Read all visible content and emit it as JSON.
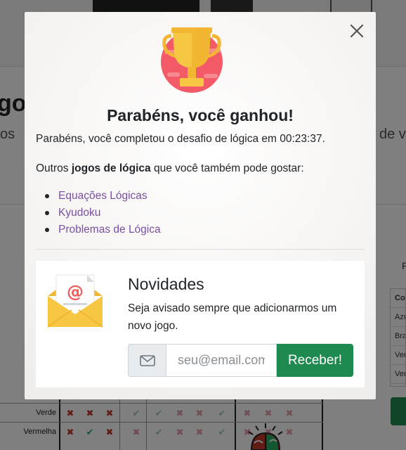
{
  "background": {
    "heading_fragment": "go",
    "sub_left_fragment": "os",
    "sub_right_fragment": "de v",
    "right_col_label": "P",
    "right_table": [
      "Co",
      "Azu",
      "Bra",
      "Ver",
      "Ver"
    ],
    "grid_rows": [
      {
        "label": "Verde",
        "cells": [
          "x",
          "x",
          "x",
          "fok",
          "fok",
          "fx",
          "fx",
          "fok",
          "fx",
          "fx",
          "fx"
        ]
      },
      {
        "label": "Vermelha",
        "cells": [
          "x",
          "ok",
          "x",
          "fx",
          "fok",
          "fx",
          "fx",
          "fok",
          "fx",
          "fx",
          "fx"
        ]
      }
    ]
  },
  "modal": {
    "close_label": "×",
    "trophy_icon": "trophy-icon",
    "title": "Parabéns, você ganhou!",
    "message": "Parabéns, você completou o desafio de lógica em 00:23:37.",
    "others_prefix": "Outros ",
    "others_bold": "jogos de lógica",
    "others_suffix": " que você também pode gostar:",
    "games": [
      {
        "label": "Equações Lógicas"
      },
      {
        "label": "Kyudoku"
      },
      {
        "label": "Problemas de Lógica"
      }
    ],
    "link_color": "#7a4fa0"
  },
  "newsletter": {
    "icon": "envelope-icon",
    "title": "Novidades",
    "text": "Seja avisado sempre que adicionarmos um novo jogo.",
    "email_placeholder": "seu@email.com",
    "submit_label": "Receber!",
    "submit_color": "#1e8a4f"
  }
}
